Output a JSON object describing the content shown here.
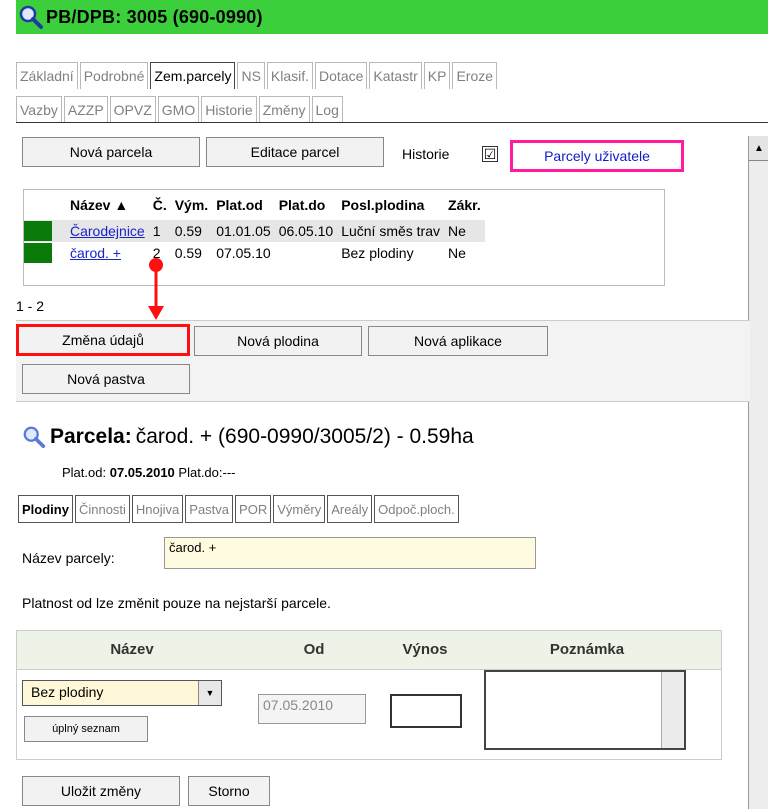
{
  "title": "PB/DPB: 3005 (690-0990)",
  "tabs_row1": [
    "Základní",
    "Podrobné",
    "Zem.parcely",
    "NS",
    "Klasif.",
    "Dotace",
    "Katastr",
    "KP",
    "Eroze"
  ],
  "tabs_row2": [
    "Vazby",
    "AZZP",
    "OPVZ",
    "GMO",
    "Historie",
    "Změny",
    "Log"
  ],
  "active_tab": "Zem.parcely",
  "toolbar": {
    "new_parcel": "Nová parcela",
    "edit_parcels": "Editace parcel",
    "history_label": "Historie",
    "history_checked": "☑",
    "user_parcels": "Parcely uživatele"
  },
  "grid": {
    "headers": [
      "",
      "Název ▲",
      "Č.",
      "Vým.",
      "Plat.od",
      "Plat.do",
      "Posl.plodina",
      "Zákr."
    ],
    "rows": [
      {
        "name": "Čarodejnice",
        "c": "1",
        "vym": "0.59",
        "od": "01.01.05",
        "do": "06.05.10",
        "plodina": "Luční směs trav",
        "zakr": "Ne"
      },
      {
        "name": "čarod. +",
        "c": "2",
        "vym": "0.59",
        "od": "07.05.10",
        "do": "",
        "plodina": "Bez plodiny",
        "zakr": "Ne"
      }
    ],
    "pager": "1 - 2",
    "row_color": "#0a7a0a"
  },
  "actions": {
    "change_data": "Změna údajů",
    "new_crop": "Nová plodina",
    "new_application": "Nová aplikace",
    "new_pasture": "Nová pastva"
  },
  "parcel": {
    "label": "Parcela:",
    "value": "čarod. + (690-0990/3005/2) - 0.59ha",
    "plat_od_label": "Plat.od:",
    "plat_od": "07.05.2010",
    "plat_do_label": "Plat.do:",
    "plat_do": "---"
  },
  "subtabs": [
    "Plodiny",
    "Činnosti",
    "Hnojiva",
    "Pastva",
    "POR",
    "Výměry",
    "Areály",
    "Odpoč.ploch."
  ],
  "name_field": {
    "label": "Název parcely:",
    "value": "čarod. +"
  },
  "note": "Platnost od lze změnit pouze na nejstarší parcele.",
  "crop_table": {
    "headers": [
      "Název",
      "Od",
      "Výnos",
      "Poznámka"
    ],
    "select_value": "Bez plodiny",
    "full_list": "úplný seznam",
    "date_value": "07.05.2010",
    "vynos_value": "",
    "note_value": ""
  },
  "footer": {
    "save": "Uložit změny",
    "cancel": "Storno"
  },
  "colors": {
    "title_bg": "#3ccf3c",
    "highlight_red": "#ff1010",
    "highlight_pink": "#ff1aa0",
    "link": "#1a24c8"
  }
}
